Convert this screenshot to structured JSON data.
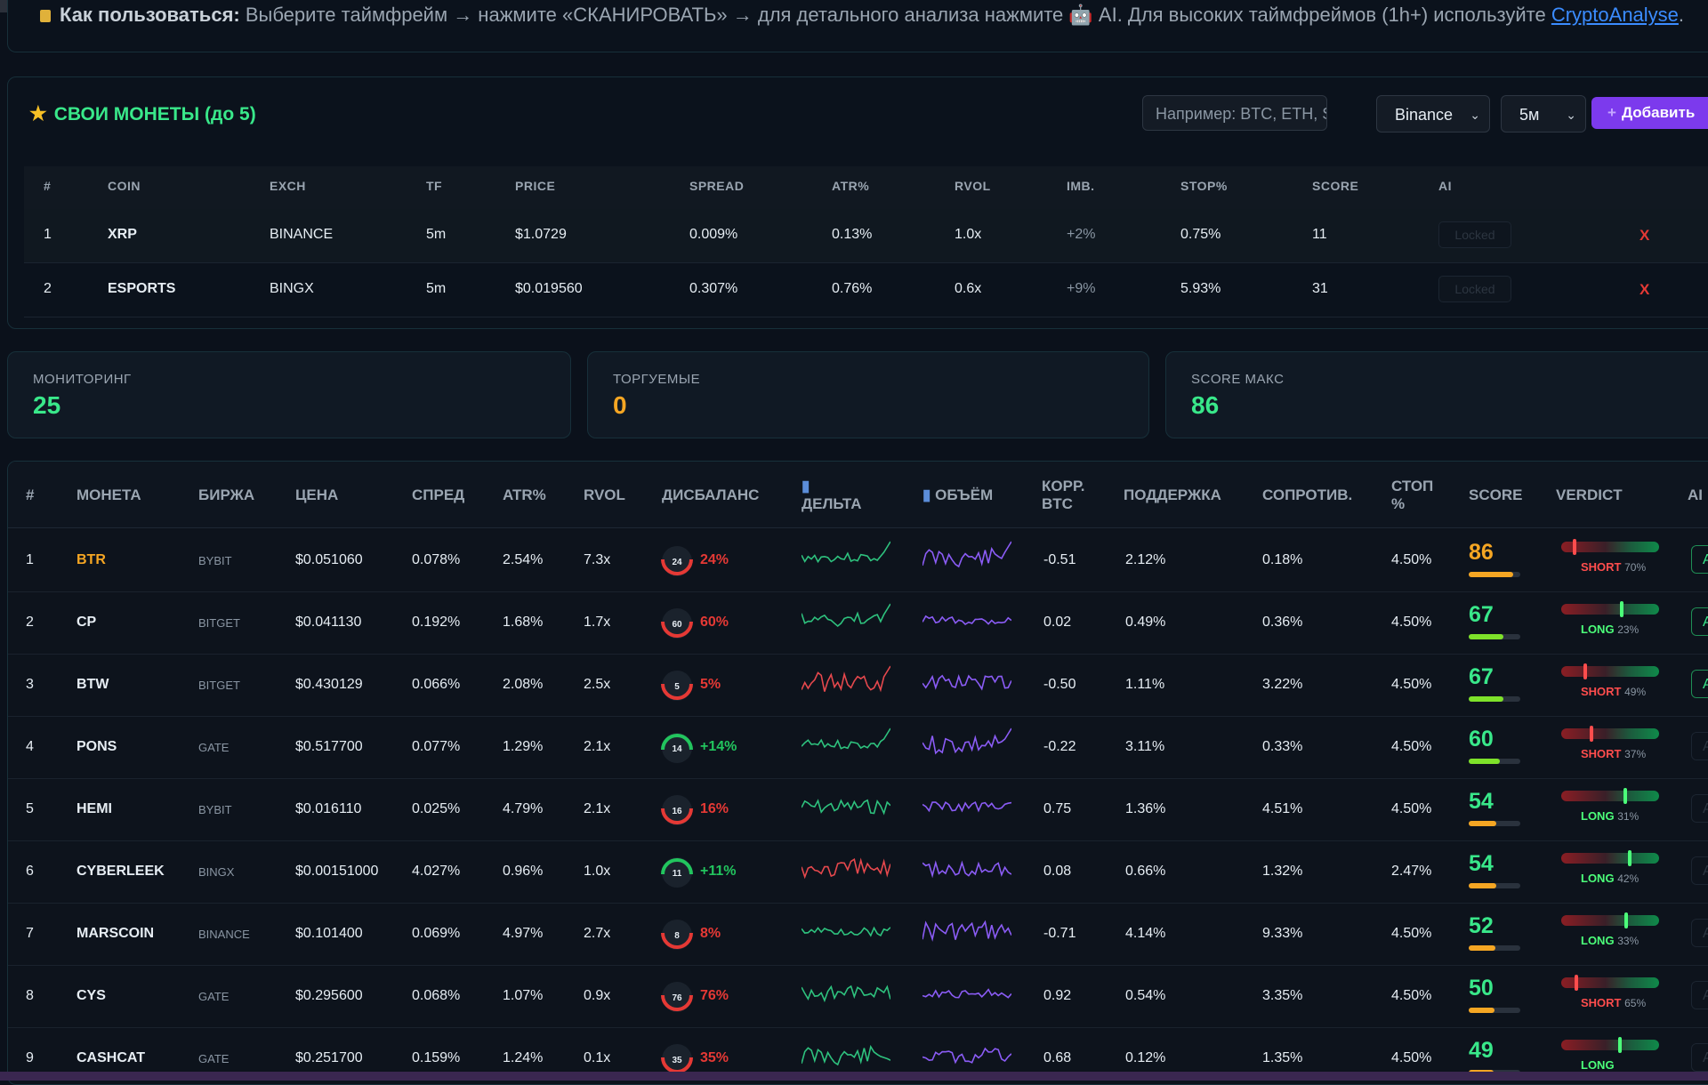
{
  "hint": {
    "bold": "Как пользоваться:",
    "text": " Выберите таймфрейм → нажмите «СКАНИРОВАТЬ» → для детального анализа нажмите 🤖 AI. Для высоких таймфреймов (1h+) используйте ",
    "link": "CryptoAnalyse",
    "end": "."
  },
  "custom": {
    "title": "СВОИ МОНЕТЫ (до 5)",
    "input_placeholder": "Например: BTC, ETH, SOL",
    "exchange_value": "Binance",
    "tf_value": "5м",
    "add_label": "Добавить",
    "headers": [
      "#",
      "COIN",
      "EXCH",
      "TF",
      "PRICE",
      "SPREAD",
      "ATR%",
      "RVOL",
      "IMB.",
      "STOP%",
      "SCORE",
      "AI"
    ],
    "rows": [
      {
        "n": "1",
        "coin": "XRP",
        "exch": "BINANCE",
        "tf": "5m",
        "price": "$1.0729",
        "spread": "0.009%",
        "atr": "0.13%",
        "rvol": "1.0x",
        "imb": "+2%",
        "stop": "0.75%",
        "score": "11",
        "ai": "Locked",
        "del": "X"
      },
      {
        "n": "2",
        "coin": "ESPORTS",
        "exch": "BINGX",
        "tf": "5m",
        "price": "$0.019560",
        "spread": "0.307%",
        "atr": "0.76%",
        "rvol": "0.6x",
        "imb": "+9%",
        "stop": "5.93%",
        "score": "31",
        "ai": "Locked",
        "del": "X"
      }
    ]
  },
  "stats": [
    {
      "label": "МОНИТОРИНГ",
      "value": "25",
      "color": "#39e88a"
    },
    {
      "label": "ТОРГУЕМЫЕ",
      "value": "0",
      "color": "#f5a623"
    },
    {
      "label": "SCORE МАКС",
      "value": "86",
      "color": "#39e88a"
    }
  ],
  "table": {
    "headers": {
      "n": "#",
      "coin": "МОНЕТА",
      "exch": "БИРЖА",
      "price": "ЦЕНА",
      "spread": "СПРЕД",
      "atr": "ATR%",
      "rvol": "RVOL",
      "imb": "ДИСБАЛАНС",
      "delta": "ДЕЛЬТА",
      "volume": "ОБЪЁМ",
      "corr1": "КОРР.",
      "corr2": "BTC",
      "support": "ПОДДЕРЖКА",
      "resist": "СОПРОТИВ.",
      "stop1": "СТОП",
      "stop2": "%",
      "score": "SCORE",
      "verdict": "VERDICT",
      "ai": "AI"
    },
    "rows": [
      {
        "n": "1",
        "coin": "BTR",
        "coin_color": "#f5a623",
        "exch": "BYBIT",
        "price": "$0.051060",
        "spread": "0.078%",
        "atr": "2.54%",
        "rvol": "7.3x",
        "gauge": "24",
        "imb": "24%",
        "imb_up": false,
        "corr": "-0.51",
        "support": "2.12%",
        "resist": "0.18%",
        "stop": "4.50%",
        "score": "86",
        "score_color": "#f5a623",
        "score_fill": 0.86,
        "verdict": "SHORT",
        "vpct": "70%",
        "vpos": 0.12,
        "ai_active": true
      },
      {
        "n": "2",
        "coin": "CP",
        "coin_color": "#e6edf3",
        "exch": "BITGET",
        "price": "$0.041130",
        "spread": "0.192%",
        "atr": "1.68%",
        "rvol": "1.7x",
        "gauge": "60",
        "imb": "60%",
        "imb_up": false,
        "corr": "0.02",
        "support": "0.49%",
        "resist": "0.36%",
        "stop": "4.50%",
        "score": "67",
        "score_color": "#39e88a",
        "score_fill": 0.67,
        "verdict": "LONG",
        "vpct": "23%",
        "vpos": 0.62,
        "ai_active": true
      },
      {
        "n": "3",
        "coin": "BTW",
        "coin_color": "#e6edf3",
        "exch": "BITGET",
        "price": "$0.430129",
        "spread": "0.066%",
        "atr": "2.08%",
        "rvol": "2.5x",
        "gauge": "5",
        "imb": "5%",
        "imb_up": false,
        "corr": "-0.50",
        "support": "1.11%",
        "resist": "3.22%",
        "stop": "4.50%",
        "score": "67",
        "score_color": "#39e88a",
        "score_fill": 0.67,
        "verdict": "SHORT",
        "vpct": "49%",
        "vpos": 0.24,
        "ai_active": true
      },
      {
        "n": "4",
        "coin": "PONS",
        "coin_color": "#e6edf3",
        "exch": "GATE",
        "price": "$0.517700",
        "spread": "0.077%",
        "atr": "1.29%",
        "rvol": "2.1x",
        "gauge": "14",
        "imb": "+14%",
        "imb_up": true,
        "corr": "-0.22",
        "support": "3.11%",
        "resist": "0.33%",
        "stop": "4.50%",
        "score": "60",
        "score_color": "#39e88a",
        "score_fill": 0.6,
        "verdict": "SHORT",
        "vpct": "37%",
        "vpos": 0.3,
        "ai_active": false
      },
      {
        "n": "5",
        "coin": "HEMI",
        "coin_color": "#e6edf3",
        "exch": "BYBIT",
        "price": "$0.016110",
        "spread": "0.025%",
        "atr": "4.79%",
        "rvol": "2.1x",
        "gauge": "16",
        "imb": "16%",
        "imb_up": false,
        "corr": "0.75",
        "support": "1.36%",
        "resist": "4.51%",
        "stop": "4.50%",
        "score": "54",
        "score_color": "#39e88a",
        "score_fill": 0.54,
        "verdict": "LONG",
        "vpct": "31%",
        "vpos": 0.66,
        "ai_active": false
      },
      {
        "n": "6",
        "coin": "CYBERLEEK",
        "coin_color": "#e6edf3",
        "exch": "BINGX",
        "price": "$0.00151000",
        "spread": "4.027%",
        "atr": "0.96%",
        "rvol": "1.0x",
        "gauge": "11",
        "imb": "+11%",
        "imb_up": true,
        "corr": "0.08",
        "support": "0.66%",
        "resist": "1.32%",
        "stop": "2.47%",
        "score": "54",
        "score_color": "#39e88a",
        "score_fill": 0.54,
        "verdict": "LONG",
        "vpct": "42%",
        "vpos": 0.71,
        "ai_active": false
      },
      {
        "n": "7",
        "coin": "MARSCOIN",
        "coin_color": "#e6edf3",
        "exch": "BINANCE",
        "price": "$0.101400",
        "spread": "0.069%",
        "atr": "4.97%",
        "rvol": "2.7x",
        "gauge": "8",
        "imb": "8%",
        "imb_up": false,
        "corr": "-0.71",
        "support": "4.14%",
        "resist": "9.33%",
        "stop": "4.50%",
        "score": "52",
        "score_color": "#39e88a",
        "score_fill": 0.52,
        "verdict": "LONG",
        "vpct": "33%",
        "vpos": 0.67,
        "ai_active": false
      },
      {
        "n": "8",
        "coin": "CYS",
        "coin_color": "#e6edf3",
        "exch": "GATE",
        "price": "$0.295600",
        "spread": "0.068%",
        "atr": "1.07%",
        "rvol": "0.9x",
        "gauge": "76",
        "imb": "76%",
        "imb_up": false,
        "corr": "0.92",
        "support": "0.54%",
        "resist": "3.35%",
        "stop": "4.50%",
        "score": "50",
        "score_color": "#39e88a",
        "score_fill": 0.5,
        "verdict": "SHORT",
        "vpct": "65%",
        "vpos": 0.14,
        "ai_active": false
      },
      {
        "n": "9",
        "coin": "CASHCAT",
        "coin_color": "#e6edf3",
        "exch": "GATE",
        "price": "$0.251700",
        "spread": "0.159%",
        "atr": "1.24%",
        "rvol": "0.1x",
        "gauge": "35",
        "imb": "35%",
        "imb_up": false,
        "corr": "0.68",
        "support": "0.12%",
        "resist": "1.35%",
        "stop": "4.50%",
        "score": "49",
        "score_color": "#39e88a",
        "score_fill": 0.49,
        "verdict": "LONG",
        "vpct": "",
        "vpos": 0.6,
        "ai_active": false
      }
    ]
  }
}
